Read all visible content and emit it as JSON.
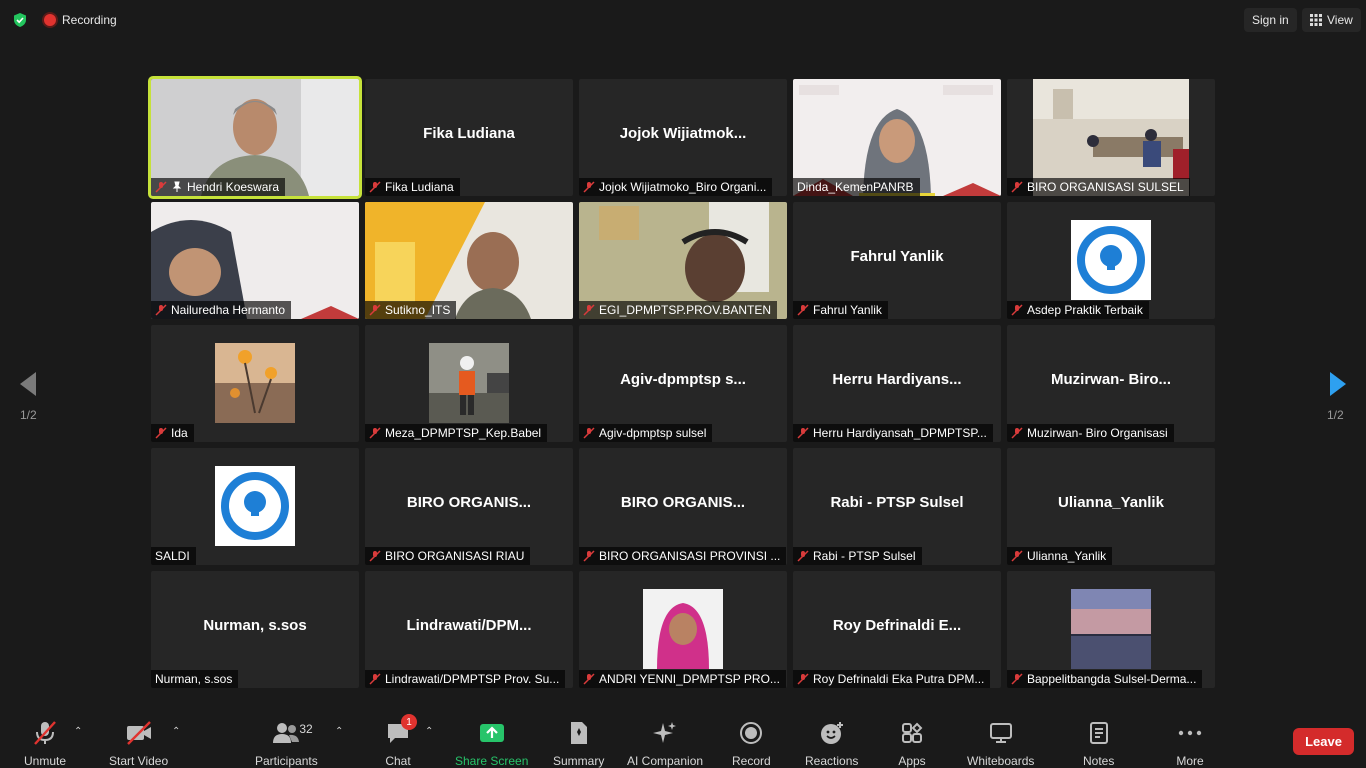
{
  "topbar": {
    "recording_label": "Recording",
    "signin_label": "Sign in",
    "view_label": "View"
  },
  "pager": {
    "left": "1/2",
    "right": "1/2"
  },
  "tiles": [
    {
      "label": "Hendri Koeswara",
      "big": ""
    },
    {
      "label": "Fika Ludiana",
      "big": "Fika Ludiana"
    },
    {
      "label": "Jojok Wijiatmoko_Biro Organi...",
      "big": "Jojok  Wijiatmok..."
    },
    {
      "label": "Dinda_KemenPANRB",
      "big": ""
    },
    {
      "label": "BIRO ORGANISASI SULSEL",
      "big": ""
    },
    {
      "label": "Nailuredha Hermanto",
      "big": ""
    },
    {
      "label": "Sutikno_ITS",
      "big": ""
    },
    {
      "label": "EGI_DPMPTSP.PROV.BANTEN",
      "big": ""
    },
    {
      "label": "Fahrul Yanlik",
      "big": "Fahrul Yanlik"
    },
    {
      "label": "Asdep Praktik Terbaik",
      "big": ""
    },
    {
      "label": "Ida",
      "big": ""
    },
    {
      "label": "Meza_DPMPTSP_Kep.Babel",
      "big": ""
    },
    {
      "label": "Agiv-dpmptsp sulsel",
      "big": "Agiv-dpmptsp  s..."
    },
    {
      "label": "Herru Hardiyansah_DPMPTSP...",
      "big": "Herru  Hardiyans..."
    },
    {
      "label": "Muzirwan- Biro Organisasi",
      "big": "Muzirwan-  Biro..."
    },
    {
      "label": "SALDI",
      "big": ""
    },
    {
      "label": "BIRO ORGANISASI RIAU",
      "big": "BIRO ORGANIS..."
    },
    {
      "label": "BIRO ORGANISASI PROVINSI ...",
      "big": "BIRO ORGANIS..."
    },
    {
      "label": "Rabi - PTSP Sulsel",
      "big": "Rabi - PTSP Sulsel"
    },
    {
      "label": "Ulianna_Yanlik",
      "big": "Ulianna_Yanlik"
    },
    {
      "label": "Nurman, s.sos",
      "big": "Nurman, s.sos"
    },
    {
      "label": "Lindrawati/DPMPTSP Prov. Su...",
      "big": "Lindrawati/DPM..."
    },
    {
      "label": "ANDRI YENNI_DPMPTSP PRO...",
      "big": ""
    },
    {
      "label": "Roy Defrinaldi Eka Putra DPM...",
      "big": "Roy  Defrinaldi  E..."
    },
    {
      "label": "Bappelitbangda Sulsel-Derma...",
      "big": ""
    }
  ],
  "toolbar": {
    "unmute": "Unmute",
    "start_video": "Start Video",
    "participants": "Participants",
    "participants_count": "32",
    "chat": "Chat",
    "chat_badge": "1",
    "share_screen": "Share Screen",
    "summary": "Summary",
    "ai_companion": "AI Companion",
    "record": "Record",
    "reactions": "Reactions",
    "apps": "Apps",
    "whiteboards": "Whiteboards",
    "notes": "Notes",
    "more": "More",
    "leave": "Leave"
  }
}
